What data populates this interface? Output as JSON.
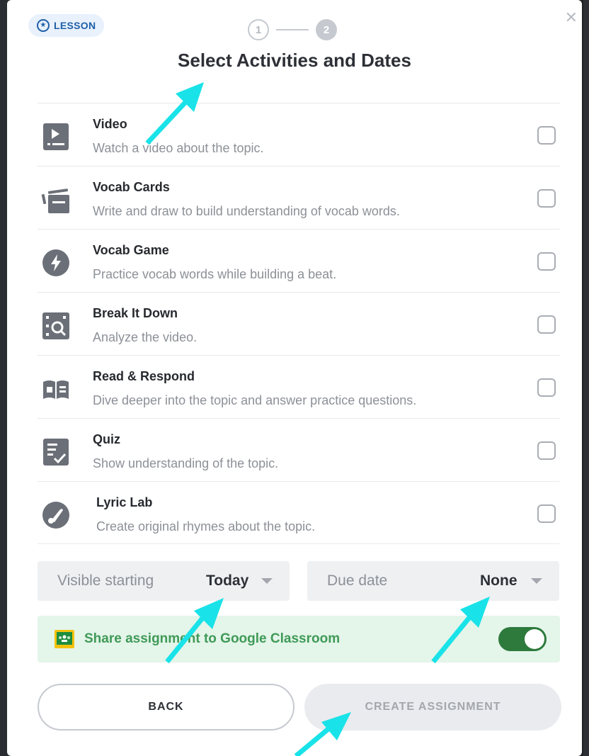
{
  "badge": {
    "label": "LESSON",
    "icon": "star-icon"
  },
  "stepper": {
    "step1": "1",
    "step2": "2"
  },
  "title": "Select Activities and Dates",
  "activities": [
    {
      "title": "Video",
      "desc": "Watch a video about the topic.",
      "icon": "video-icon",
      "checked": false
    },
    {
      "title": "Vocab Cards",
      "desc": "Write and draw to build understanding of vocab words.",
      "icon": "vocab-cards-icon",
      "checked": false
    },
    {
      "title": "Vocab Game",
      "desc": "Practice vocab words while building a beat.",
      "icon": "lightning-icon",
      "checked": false
    },
    {
      "title": "Break It Down",
      "desc": "Analyze the video.",
      "icon": "magnify-icon",
      "checked": false
    },
    {
      "title": "Read & Respond",
      "desc": "Dive deeper into the topic and answer practice questions.",
      "icon": "book-icon",
      "checked": false
    },
    {
      "title": "Quiz",
      "desc": "Show understanding of the topic.",
      "icon": "quiz-icon",
      "checked": false
    },
    {
      "title": "Lyric Lab",
      "desc": "Create original rhymes about the topic.",
      "icon": "music-note-icon",
      "checked": false
    }
  ],
  "dates": {
    "visible_label": "Visible starting",
    "visible_value": "Today",
    "due_label": "Due date",
    "due_value": "None"
  },
  "share": {
    "label": "Share assignment to Google Classroom",
    "enabled": true,
    "icon": "google-classroom-icon"
  },
  "buttons": {
    "back": "BACK",
    "create": "CREATE ASSIGNMENT"
  },
  "colors": {
    "accent_green": "#2d7a3c",
    "annotation_arrow": "#19e3e8",
    "badge_blue": "#1f5fa8"
  }
}
